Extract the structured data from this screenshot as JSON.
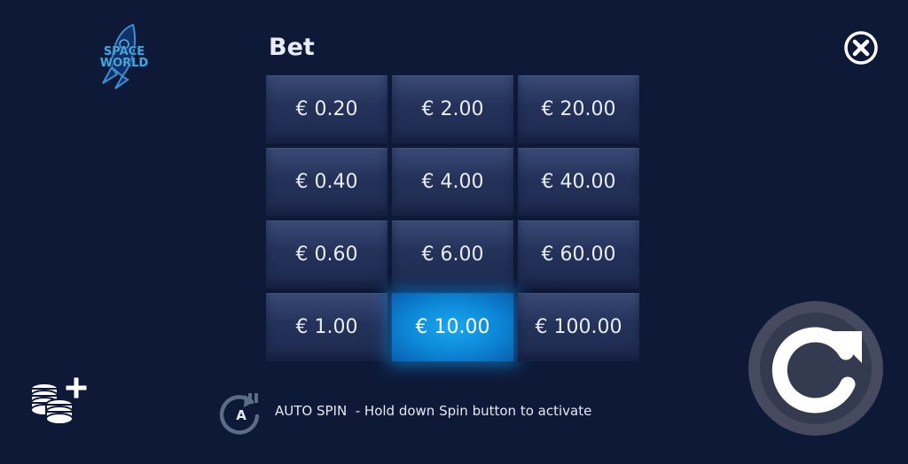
{
  "logo": {
    "line1": "SPACE",
    "line2": "WORLD"
  },
  "bet_panel": {
    "title": "Bet",
    "currency": "€",
    "options": [
      [
        "€ 0.20",
        "€ 2.00",
        "€ 20.00"
      ],
      [
        "€ 0.40",
        "€ 4.00",
        "€ 40.00"
      ],
      [
        "€ 0.60",
        "€ 6.00",
        "€ 60.00"
      ],
      [
        "€ 1.00",
        "€ 10.00",
        "€ 100.00"
      ]
    ],
    "selected": "€ 10.00"
  },
  "autospin": {
    "icon_letter": "A",
    "label": "AUTO SPIN",
    "hint": "- Hold down Spin button to activate"
  },
  "icons": {
    "close": "close-icon",
    "coins": "coins-plus-icon",
    "autospin": "autospin-icon",
    "spin": "spin-icon"
  },
  "colors": {
    "background": "#0e1937",
    "selected": "#0c86d6",
    "cell": "#2a385f"
  }
}
